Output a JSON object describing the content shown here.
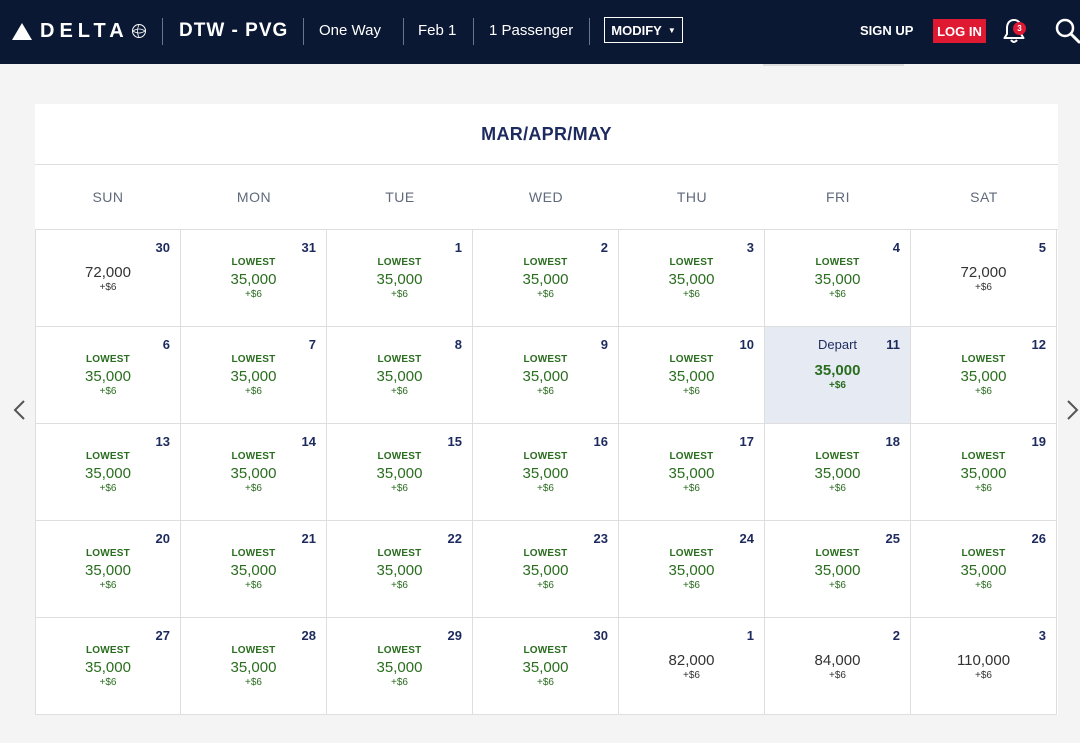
{
  "header": {
    "logo_text": "DELTA",
    "route": "DTW - PVG",
    "trip_type": "One Way",
    "date": "Feb 1",
    "passengers": "1 Passenger",
    "modify_label": "MODIFY",
    "signup_label": "SIGN UP",
    "login_label": "LOG IN",
    "notification_count": "3",
    "brand_color": "#0b1833",
    "login_color": "#e01933"
  },
  "calendar": {
    "title": "MAR/APR/MAY",
    "days_of_week": [
      "SUN",
      "MON",
      "TUE",
      "WED",
      "THU",
      "FRI",
      "SAT"
    ],
    "price_color": "#2a6d1f",
    "selected_label": "Depart",
    "weeks": [
      [
        {
          "day": "30",
          "label": "",
          "price": "72,000",
          "fee": "+$6"
        },
        {
          "day": "31",
          "label": "LOWEST",
          "price": "35,000",
          "fee": "+$6"
        },
        {
          "day": "1",
          "label": "LOWEST",
          "price": "35,000",
          "fee": "+$6"
        },
        {
          "day": "2",
          "label": "LOWEST",
          "price": "35,000",
          "fee": "+$6"
        },
        {
          "day": "3",
          "label": "LOWEST",
          "price": "35,000",
          "fee": "+$6"
        },
        {
          "day": "4",
          "label": "LOWEST",
          "price": "35,000",
          "fee": "+$6"
        },
        {
          "day": "5",
          "label": "",
          "price": "72,000",
          "fee": "+$6"
        }
      ],
      [
        {
          "day": "6",
          "label": "LOWEST",
          "price": "35,000",
          "fee": "+$6"
        },
        {
          "day": "7",
          "label": "LOWEST",
          "price": "35,000",
          "fee": "+$6"
        },
        {
          "day": "8",
          "label": "LOWEST",
          "price": "35,000",
          "fee": "+$6"
        },
        {
          "day": "9",
          "label": "LOWEST",
          "price": "35,000",
          "fee": "+$6"
        },
        {
          "day": "10",
          "label": "LOWEST",
          "price": "35,000",
          "fee": "+$6"
        },
        {
          "day": "11",
          "label": "",
          "price": "35,000",
          "fee": "+$6",
          "selected": true
        },
        {
          "day": "12",
          "label": "LOWEST",
          "price": "35,000",
          "fee": "+$6"
        }
      ],
      [
        {
          "day": "13",
          "label": "LOWEST",
          "price": "35,000",
          "fee": "+$6"
        },
        {
          "day": "14",
          "label": "LOWEST",
          "price": "35,000",
          "fee": "+$6"
        },
        {
          "day": "15",
          "label": "LOWEST",
          "price": "35,000",
          "fee": "+$6"
        },
        {
          "day": "16",
          "label": "LOWEST",
          "price": "35,000",
          "fee": "+$6"
        },
        {
          "day": "17",
          "label": "LOWEST",
          "price": "35,000",
          "fee": "+$6"
        },
        {
          "day": "18",
          "label": "LOWEST",
          "price": "35,000",
          "fee": "+$6"
        },
        {
          "day": "19",
          "label": "LOWEST",
          "price": "35,000",
          "fee": "+$6"
        }
      ],
      [
        {
          "day": "20",
          "label": "LOWEST",
          "price": "35,000",
          "fee": "+$6"
        },
        {
          "day": "21",
          "label": "LOWEST",
          "price": "35,000",
          "fee": "+$6"
        },
        {
          "day": "22",
          "label": "LOWEST",
          "price": "35,000",
          "fee": "+$6"
        },
        {
          "day": "23",
          "label": "LOWEST",
          "price": "35,000",
          "fee": "+$6"
        },
        {
          "day": "24",
          "label": "LOWEST",
          "price": "35,000",
          "fee": "+$6"
        },
        {
          "day": "25",
          "label": "LOWEST",
          "price": "35,000",
          "fee": "+$6"
        },
        {
          "day": "26",
          "label": "LOWEST",
          "price": "35,000",
          "fee": "+$6"
        }
      ],
      [
        {
          "day": "27",
          "label": "LOWEST",
          "price": "35,000",
          "fee": "+$6"
        },
        {
          "day": "28",
          "label": "LOWEST",
          "price": "35,000",
          "fee": "+$6"
        },
        {
          "day": "29",
          "label": "LOWEST",
          "price": "35,000",
          "fee": "+$6"
        },
        {
          "day": "30",
          "label": "LOWEST",
          "price": "35,000",
          "fee": "+$6"
        },
        {
          "day": "1",
          "label": "",
          "price": "82,000",
          "fee": "+$6"
        },
        {
          "day": "2",
          "label": "",
          "price": "84,000",
          "fee": "+$6"
        },
        {
          "day": "3",
          "label": "",
          "price": "110,000",
          "fee": "+$6"
        }
      ]
    ]
  }
}
